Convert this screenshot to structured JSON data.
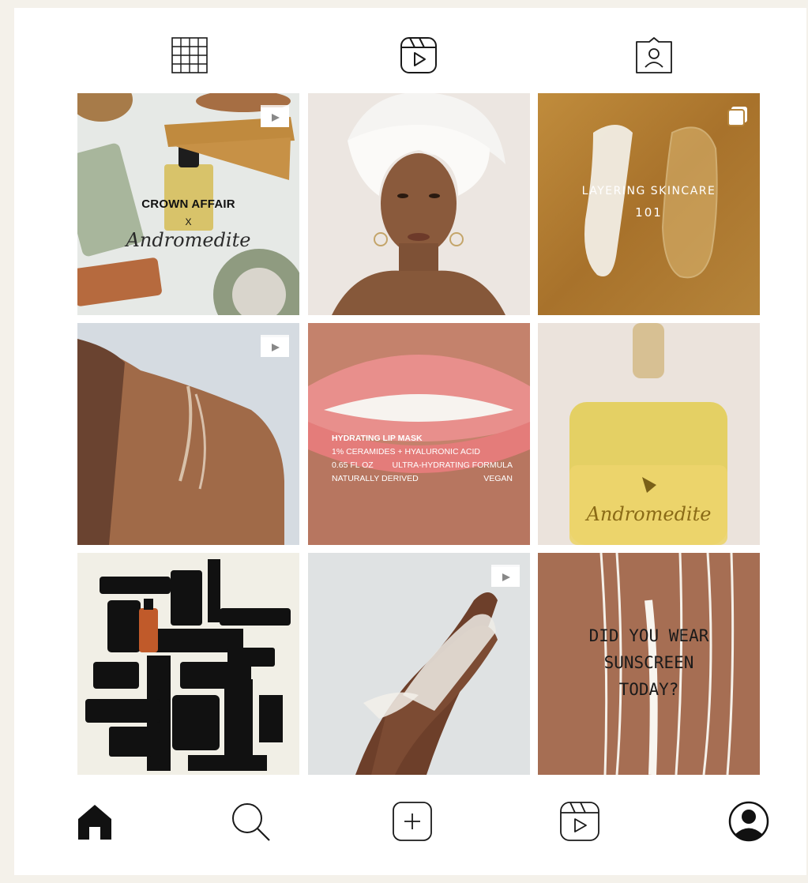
{
  "top_tabs": [
    {
      "icon": "grid-icon"
    },
    {
      "icon": "reels-icon"
    },
    {
      "icon": "tagged-icon"
    }
  ],
  "posts": [
    {
      "icon": "reel-badge-icon",
      "text": [
        "CROWN AFFAIR",
        "X",
        "Andromedite"
      ]
    },
    {
      "icon": null,
      "text": []
    },
    {
      "icon": "carousel-badge-icon",
      "text": [
        "LAYERING SKINCARE",
        "101"
      ]
    },
    {
      "icon": "reel-badge-icon",
      "text": []
    },
    {
      "icon": null,
      "text": [
        "HYDRATING LIP MASK",
        "1% CERAMIDES + HYALURONIC ACID",
        "0.65 FL OZ",
        "ULTRA-HYDRATING FORMULA",
        "NATURALLY DERIVED",
        "VEGAN"
      ]
    },
    {
      "icon": null,
      "text": [
        "Andromedite"
      ]
    },
    {
      "icon": null,
      "text": []
    },
    {
      "icon": "reel-badge-icon",
      "text": []
    },
    {
      "icon": null,
      "text": [
        "DID YOU WEAR",
        "SUNSCREEN",
        "TODAY?"
      ]
    }
  ],
  "bottom_nav": [
    {
      "icon": "home-icon"
    },
    {
      "icon": "search-icon"
    },
    {
      "icon": "create-icon"
    },
    {
      "icon": "reels-icon"
    },
    {
      "icon": "profile-icon"
    }
  ],
  "colors": {
    "background": "#f4f1ea",
    "surface": "#ffffff",
    "icon": "#1a1a1a"
  }
}
